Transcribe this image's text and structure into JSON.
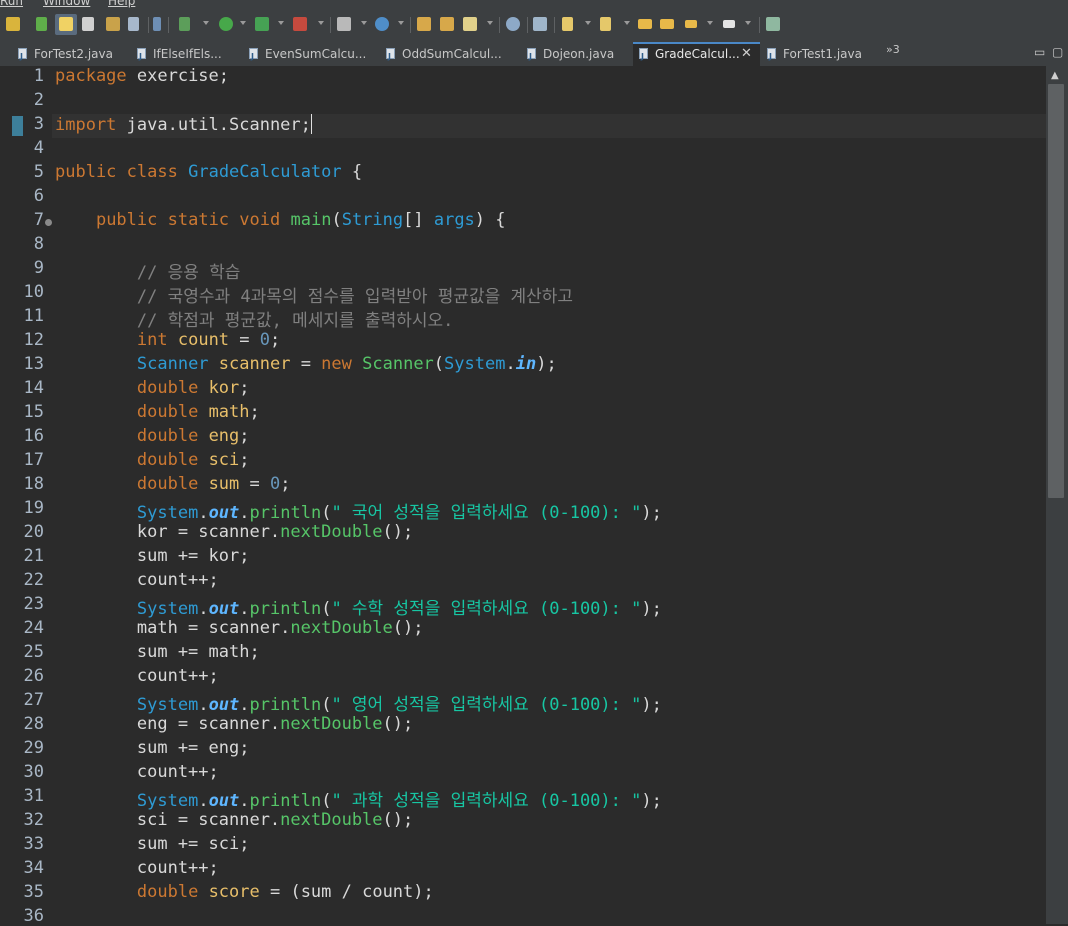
{
  "menu": {
    "items": [
      "Run",
      "Window",
      "Help"
    ]
  },
  "toolbar": {
    "icons": [
      "toggle-breakpoint-icon",
      "skip-breakpoints-icon",
      "mark-occurrences-icon",
      "search-icon",
      "new-file-icon",
      "clipboard-icon",
      "show-whitespace-icon",
      "debug-icon",
      "run-icon",
      "external-tools-icon",
      "coverage-icon",
      "new-package-icon",
      "new-class-icon",
      "open-type-icon",
      "open-resource-icon",
      "edit-icon",
      "web-icon",
      "search-tools-icon",
      "next-annotation-icon",
      "prev-annotation-icon",
      "back-icon",
      "forward-icon",
      "go-back-icon",
      "go-forward-icon",
      "perspective-icon"
    ]
  },
  "tabs": [
    {
      "label": "ForTest2.java",
      "active": false
    },
    {
      "label": "IfElseIfEls...",
      "active": false
    },
    {
      "label": "EvenSumCalcu...",
      "active": false
    },
    {
      "label": "OddSumCalcul...",
      "active": false
    },
    {
      "label": "Dojeon.java",
      "active": false
    },
    {
      "label": "GradeCalcul...",
      "active": true
    },
    {
      "label": "ForTest1.java",
      "active": false
    }
  ],
  "tab_overflow": "»3",
  "editor": {
    "lines": [
      [
        {
          "t": "package",
          "c": "kw"
        },
        {
          "t": " exercise;",
          "c": "plain"
        }
      ],
      [],
      [
        {
          "t": "import",
          "c": "kw"
        },
        {
          "t": " java.util.Scanner;",
          "c": "plain"
        }
      ],
      [],
      [
        {
          "t": "public",
          "c": "kw"
        },
        {
          "t": " ",
          "c": "plain"
        },
        {
          "t": "class",
          "c": "kw"
        },
        {
          "t": " ",
          "c": "plain"
        },
        {
          "t": "GradeCalculator",
          "c": "cls"
        },
        {
          "t": " {",
          "c": "plain"
        }
      ],
      [],
      [
        {
          "t": "    ",
          "c": "plain"
        },
        {
          "t": "public",
          "c": "kw"
        },
        {
          "t": " ",
          "c": "plain"
        },
        {
          "t": "static",
          "c": "kw"
        },
        {
          "t": " ",
          "c": "plain"
        },
        {
          "t": "void",
          "c": "kw"
        },
        {
          "t": " ",
          "c": "plain"
        },
        {
          "t": "main",
          "c": "fn"
        },
        {
          "t": "(",
          "c": "plain"
        },
        {
          "t": "String",
          "c": "cls"
        },
        {
          "t": "[] ",
          "c": "plain"
        },
        {
          "t": "args",
          "c": "cls"
        },
        {
          "t": ") {",
          "c": "plain"
        }
      ],
      [],
      [
        {
          "t": "        // 응용 학습",
          "c": "cmt"
        }
      ],
      [
        {
          "t": "        // 국영수과 4과목의 점수를 입력받아 평균값을 계산하고",
          "c": "cmt"
        }
      ],
      [
        {
          "t": "        // 학점과 평균값, 메세지를 출력하시오.",
          "c": "cmt"
        }
      ],
      [
        {
          "t": "        ",
          "c": "plain"
        },
        {
          "t": "int",
          "c": "kw"
        },
        {
          "t": " ",
          "c": "plain"
        },
        {
          "t": "count",
          "c": "var"
        },
        {
          "t": " = ",
          "c": "plain"
        },
        {
          "t": "0",
          "c": "num"
        },
        {
          "t": ";",
          "c": "plain"
        }
      ],
      [
        {
          "t": "        ",
          "c": "plain"
        },
        {
          "t": "Scanner",
          "c": "cls"
        },
        {
          "t": " ",
          "c": "plain"
        },
        {
          "t": "scanner",
          "c": "var"
        },
        {
          "t": " = ",
          "c": "plain"
        },
        {
          "t": "new",
          "c": "kw"
        },
        {
          "t": " ",
          "c": "plain"
        },
        {
          "t": "Scanner",
          "c": "fn"
        },
        {
          "t": "(",
          "c": "plain"
        },
        {
          "t": "System",
          "c": "cls"
        },
        {
          "t": ".",
          "c": "plain"
        },
        {
          "t": "in",
          "c": "fld"
        },
        {
          "t": ");",
          "c": "plain"
        }
      ],
      [
        {
          "t": "        ",
          "c": "plain"
        },
        {
          "t": "double",
          "c": "kw"
        },
        {
          "t": " ",
          "c": "plain"
        },
        {
          "t": "kor",
          "c": "var"
        },
        {
          "t": ";",
          "c": "plain"
        }
      ],
      [
        {
          "t": "        ",
          "c": "plain"
        },
        {
          "t": "double",
          "c": "kw"
        },
        {
          "t": " ",
          "c": "plain"
        },
        {
          "t": "math",
          "c": "var"
        },
        {
          "t": ";",
          "c": "plain"
        }
      ],
      [
        {
          "t": "        ",
          "c": "plain"
        },
        {
          "t": "double",
          "c": "kw"
        },
        {
          "t": " ",
          "c": "plain"
        },
        {
          "t": "eng",
          "c": "var"
        },
        {
          "t": ";",
          "c": "plain"
        }
      ],
      [
        {
          "t": "        ",
          "c": "plain"
        },
        {
          "t": "double",
          "c": "kw"
        },
        {
          "t": " ",
          "c": "plain"
        },
        {
          "t": "sci",
          "c": "var"
        },
        {
          "t": ";",
          "c": "plain"
        }
      ],
      [
        {
          "t": "        ",
          "c": "plain"
        },
        {
          "t": "double",
          "c": "kw"
        },
        {
          "t": " ",
          "c": "plain"
        },
        {
          "t": "sum",
          "c": "var"
        },
        {
          "t": " = ",
          "c": "plain"
        },
        {
          "t": "0",
          "c": "num"
        },
        {
          "t": ";",
          "c": "plain"
        }
      ],
      [
        {
          "t": "        ",
          "c": "plain"
        },
        {
          "t": "System",
          "c": "cls"
        },
        {
          "t": ".",
          "c": "plain"
        },
        {
          "t": "out",
          "c": "fld"
        },
        {
          "t": ".",
          "c": "plain"
        },
        {
          "t": "println",
          "c": "fn"
        },
        {
          "t": "(",
          "c": "plain"
        },
        {
          "t": "\" 국어 성적을 입력하세요 (0-100): \"",
          "c": "str"
        },
        {
          "t": ");",
          "c": "plain"
        }
      ],
      [
        {
          "t": "        kor = scanner.",
          "c": "plain"
        },
        {
          "t": "nextDouble",
          "c": "fn"
        },
        {
          "t": "();",
          "c": "plain"
        }
      ],
      [
        {
          "t": "        sum += kor;",
          "c": "plain"
        }
      ],
      [
        {
          "t": "        count++;",
          "c": "plain"
        }
      ],
      [
        {
          "t": "        ",
          "c": "plain"
        },
        {
          "t": "System",
          "c": "cls"
        },
        {
          "t": ".",
          "c": "plain"
        },
        {
          "t": "out",
          "c": "fld"
        },
        {
          "t": ".",
          "c": "plain"
        },
        {
          "t": "println",
          "c": "fn"
        },
        {
          "t": "(",
          "c": "plain"
        },
        {
          "t": "\" 수학 성적을 입력하세요 (0-100): \"",
          "c": "str"
        },
        {
          "t": ");",
          "c": "plain"
        }
      ],
      [
        {
          "t": "        math = scanner.",
          "c": "plain"
        },
        {
          "t": "nextDouble",
          "c": "fn"
        },
        {
          "t": "();",
          "c": "plain"
        }
      ],
      [
        {
          "t": "        sum += math;",
          "c": "plain"
        }
      ],
      [
        {
          "t": "        count++;",
          "c": "plain"
        }
      ],
      [
        {
          "t": "        ",
          "c": "plain"
        },
        {
          "t": "System",
          "c": "cls"
        },
        {
          "t": ".",
          "c": "plain"
        },
        {
          "t": "out",
          "c": "fld"
        },
        {
          "t": ".",
          "c": "plain"
        },
        {
          "t": "println",
          "c": "fn"
        },
        {
          "t": "(",
          "c": "plain"
        },
        {
          "t": "\" 영어 성적을 입력하세요 (0-100): \"",
          "c": "str"
        },
        {
          "t": ");",
          "c": "plain"
        }
      ],
      [
        {
          "t": "        eng = scanner.",
          "c": "plain"
        },
        {
          "t": "nextDouble",
          "c": "fn"
        },
        {
          "t": "();",
          "c": "plain"
        }
      ],
      [
        {
          "t": "        sum += eng;",
          "c": "plain"
        }
      ],
      [
        {
          "t": "        count++;",
          "c": "plain"
        }
      ],
      [
        {
          "t": "        ",
          "c": "plain"
        },
        {
          "t": "System",
          "c": "cls"
        },
        {
          "t": ".",
          "c": "plain"
        },
        {
          "t": "out",
          "c": "fld"
        },
        {
          "t": ".",
          "c": "plain"
        },
        {
          "t": "println",
          "c": "fn"
        },
        {
          "t": "(",
          "c": "plain"
        },
        {
          "t": "\" 과학 성적을 입력하세요 (0-100): \"",
          "c": "str"
        },
        {
          "t": ");",
          "c": "plain"
        }
      ],
      [
        {
          "t": "        sci = scanner.",
          "c": "plain"
        },
        {
          "t": "nextDouble",
          "c": "fn"
        },
        {
          "t": "();",
          "c": "plain"
        }
      ],
      [
        {
          "t": "        sum += sci;",
          "c": "plain"
        }
      ],
      [
        {
          "t": "        count++;",
          "c": "plain"
        }
      ],
      [
        {
          "t": "        ",
          "c": "plain"
        },
        {
          "t": "double",
          "c": "kw"
        },
        {
          "t": " ",
          "c": "plain"
        },
        {
          "t": "score",
          "c": "var"
        },
        {
          "t": " = (sum / count);",
          "c": "plain"
        }
      ],
      []
    ],
    "current_line": 3,
    "colors": {
      "keyword": "#cc7832",
      "type": "#2e9bd4",
      "method": "#56c568",
      "string": "#17c6a3",
      "number": "#6897bb",
      "comment": "#808080",
      "field": "#5eb6ff",
      "variable": "#e8bf6a"
    }
  }
}
